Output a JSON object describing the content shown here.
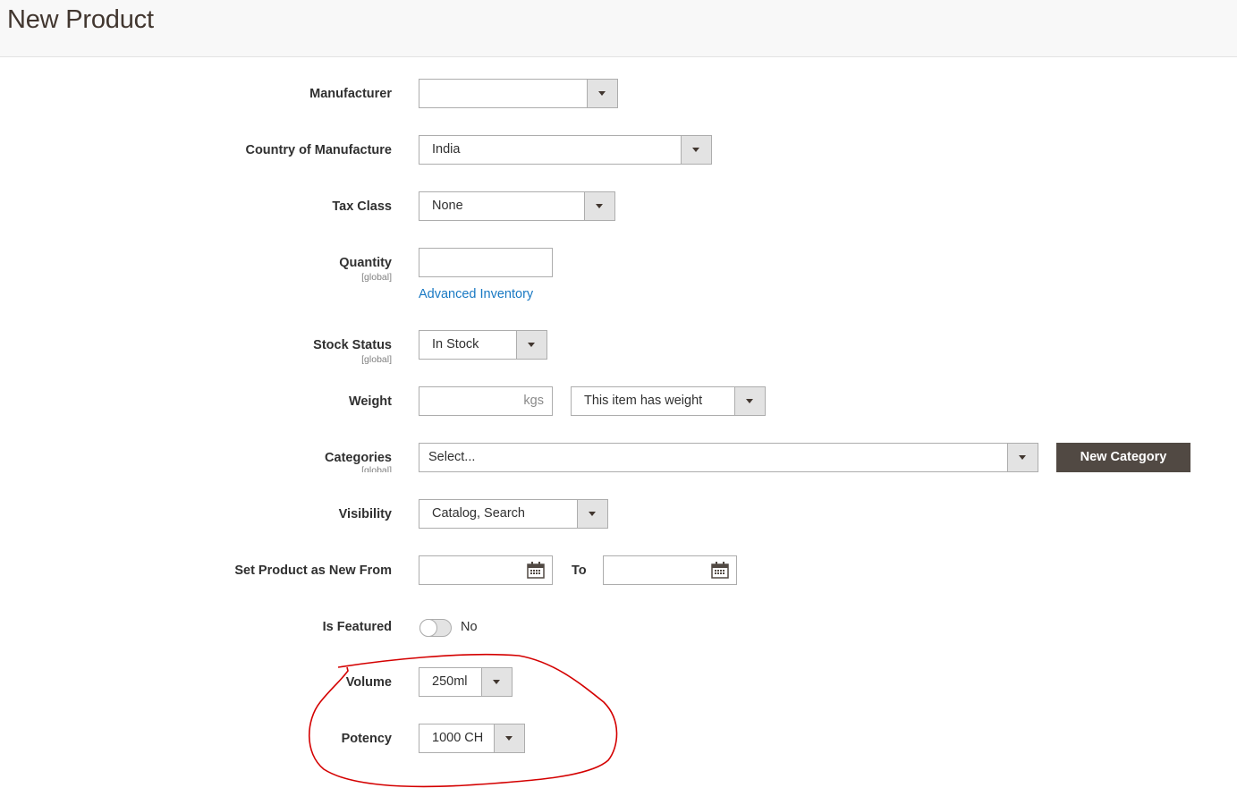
{
  "header": {
    "title": "New Product"
  },
  "form": {
    "manufacturer": {
      "label": "Manufacturer",
      "value": ""
    },
    "country": {
      "label": "Country of Manufacture",
      "value": "India"
    },
    "tax_class": {
      "label": "Tax Class",
      "value": "None"
    },
    "quantity": {
      "label": "Quantity",
      "scope": "[global]",
      "value": "",
      "advanced_link": "Advanced Inventory"
    },
    "stock_status": {
      "label": "Stock Status",
      "scope": "[global]",
      "value": "In Stock"
    },
    "weight": {
      "label": "Weight",
      "value": "",
      "unit": "kgs",
      "type_value": "This item has weight"
    },
    "categories": {
      "label": "Categories",
      "scope": "[global]",
      "placeholder": "Select...",
      "new_button": "New Category"
    },
    "visibility": {
      "label": "Visibility",
      "value": "Catalog, Search"
    },
    "new_from": {
      "label": "Set Product as New From",
      "from_value": "",
      "to_label": "To",
      "to_value": ""
    },
    "is_featured": {
      "label": "Is Featured",
      "state_label": "No",
      "checked": false
    },
    "volume": {
      "label": "Volume",
      "value": "250ml"
    },
    "potency": {
      "label": "Potency",
      "value": "1000 CH"
    }
  },
  "icons": {
    "dropdown": "chevron-down-icon",
    "calendar": "calendar-icon"
  },
  "colors": {
    "accent_link": "#1979c3",
    "dark_button": "#514943",
    "annotation": "#d40000"
  }
}
